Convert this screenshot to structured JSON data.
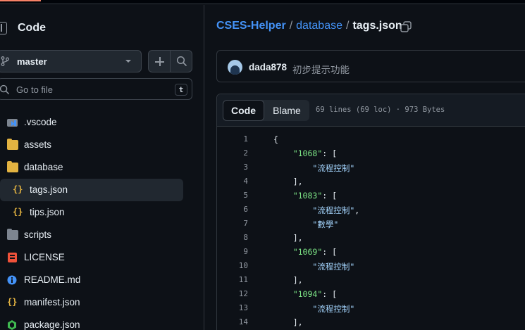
{
  "sidebar": {
    "title": "Code",
    "branch": "master",
    "goto_placeholder": "Go to file",
    "goto_shortcut": "t",
    "tree": [
      {
        "name": ".vscode",
        "icon": "vscode-folder-icon",
        "level": 0
      },
      {
        "name": "assets",
        "icon": "folder-icon",
        "level": 0
      },
      {
        "name": "database",
        "icon": "folder-open-icon",
        "level": 0
      },
      {
        "name": "tags.json",
        "icon": "json-icon",
        "level": 1,
        "active": true
      },
      {
        "name": "tips.json",
        "icon": "json-icon",
        "level": 1
      },
      {
        "name": "scripts",
        "icon": "folder-icon",
        "level": 0
      },
      {
        "name": "LICENSE",
        "icon": "license-icon",
        "level": 0
      },
      {
        "name": "README.md",
        "icon": "info-icon",
        "level": 0
      },
      {
        "name": "manifest.json",
        "icon": "json-icon",
        "level": 0
      },
      {
        "name": "package.json",
        "icon": "node-icon",
        "level": 0
      }
    ]
  },
  "breadcrumb": {
    "repo": "CSES-Helper",
    "folder": "database",
    "file": "tags.json",
    "separator": "/"
  },
  "commit": {
    "author": "dada878",
    "message": "初步提示功能"
  },
  "file": {
    "tab_code": "Code",
    "tab_blame": "Blame",
    "meta": "69 lines (69 loc) · 973 Bytes",
    "lines": [
      {
        "n": "1",
        "text": "{"
      },
      {
        "n": "2",
        "key": "\"1068\"",
        "rest": ": ["
      },
      {
        "n": "3",
        "str": "\"流程控制\""
      },
      {
        "n": "4",
        "text": "],"
      },
      {
        "n": "5",
        "key": "\"1083\"",
        "rest": ": ["
      },
      {
        "n": "6",
        "str": "\"流程控制\"",
        "rest": ","
      },
      {
        "n": "7",
        "str": "\"數學\""
      },
      {
        "n": "8",
        "text": "],"
      },
      {
        "n": "9",
        "key": "\"1069\"",
        "rest": ": ["
      },
      {
        "n": "10",
        "str": "\"流程控制\""
      },
      {
        "n": "11",
        "text": "],"
      },
      {
        "n": "12",
        "key": "\"1094\"",
        "rest": ": ["
      },
      {
        "n": "13",
        "str": "\"流程控制\""
      },
      {
        "n": "14",
        "text": "],"
      }
    ]
  },
  "colors": {
    "accent": "#4493f8",
    "json_key": "#7ee787",
    "json_string": "#a5d6ff",
    "folder": "#e3b341"
  }
}
